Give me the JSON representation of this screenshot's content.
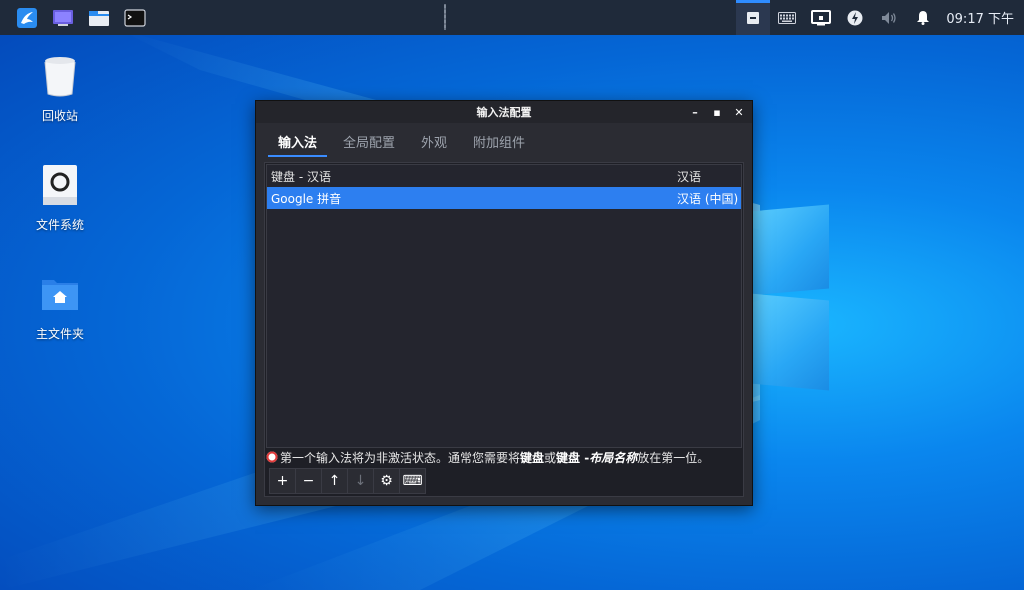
{
  "panel": {
    "clock": "09:17 下午",
    "launchers": [
      "kylin-menu-icon",
      "desktop-icon",
      "file-manager-icon",
      "terminal-icon"
    ],
    "tray": [
      "fcitx-icon",
      "keyboard-icon",
      "display-icon",
      "power-icon",
      "volume-icon",
      "notification-icon"
    ]
  },
  "desktop": {
    "icons": [
      {
        "label": "回收站",
        "icon": "trash-icon"
      },
      {
        "label": "文件系统",
        "icon": "drive-icon"
      },
      {
        "label": "主文件夹",
        "icon": "home-folder-icon"
      }
    ]
  },
  "window": {
    "title": "输入法配置",
    "controls": {
      "minimize": "–",
      "maximize": "▪",
      "close": "✕"
    },
    "tabs": [
      {
        "label": "输入法",
        "active": true
      },
      {
        "label": "全局配置",
        "active": false
      },
      {
        "label": "外观",
        "active": false
      },
      {
        "label": "附加组件",
        "active": false
      }
    ],
    "input_methods": [
      {
        "name": "键盘 - 汉语",
        "language": "汉语",
        "selected": false
      },
      {
        "name": "Google 拼音",
        "language": "汉语 (中国)",
        "selected": true
      }
    ],
    "note": {
      "prefix": "第一个输入法将为非激活状态。通常您需要将",
      "bold1": "键盘",
      "mid": "或",
      "bold2": "键盘 - ",
      "italic": "布局名称",
      "suffix": "放在第一位。"
    },
    "toolbar": {
      "add": "+",
      "remove": "−",
      "up": "↑",
      "down": "↓",
      "configure": "⚙",
      "keyboard": "⌨"
    }
  },
  "colors": {
    "accent": "#2d7ff0",
    "panel_bg": "#1f2a3a",
    "window_bg": "#2b2c33"
  }
}
